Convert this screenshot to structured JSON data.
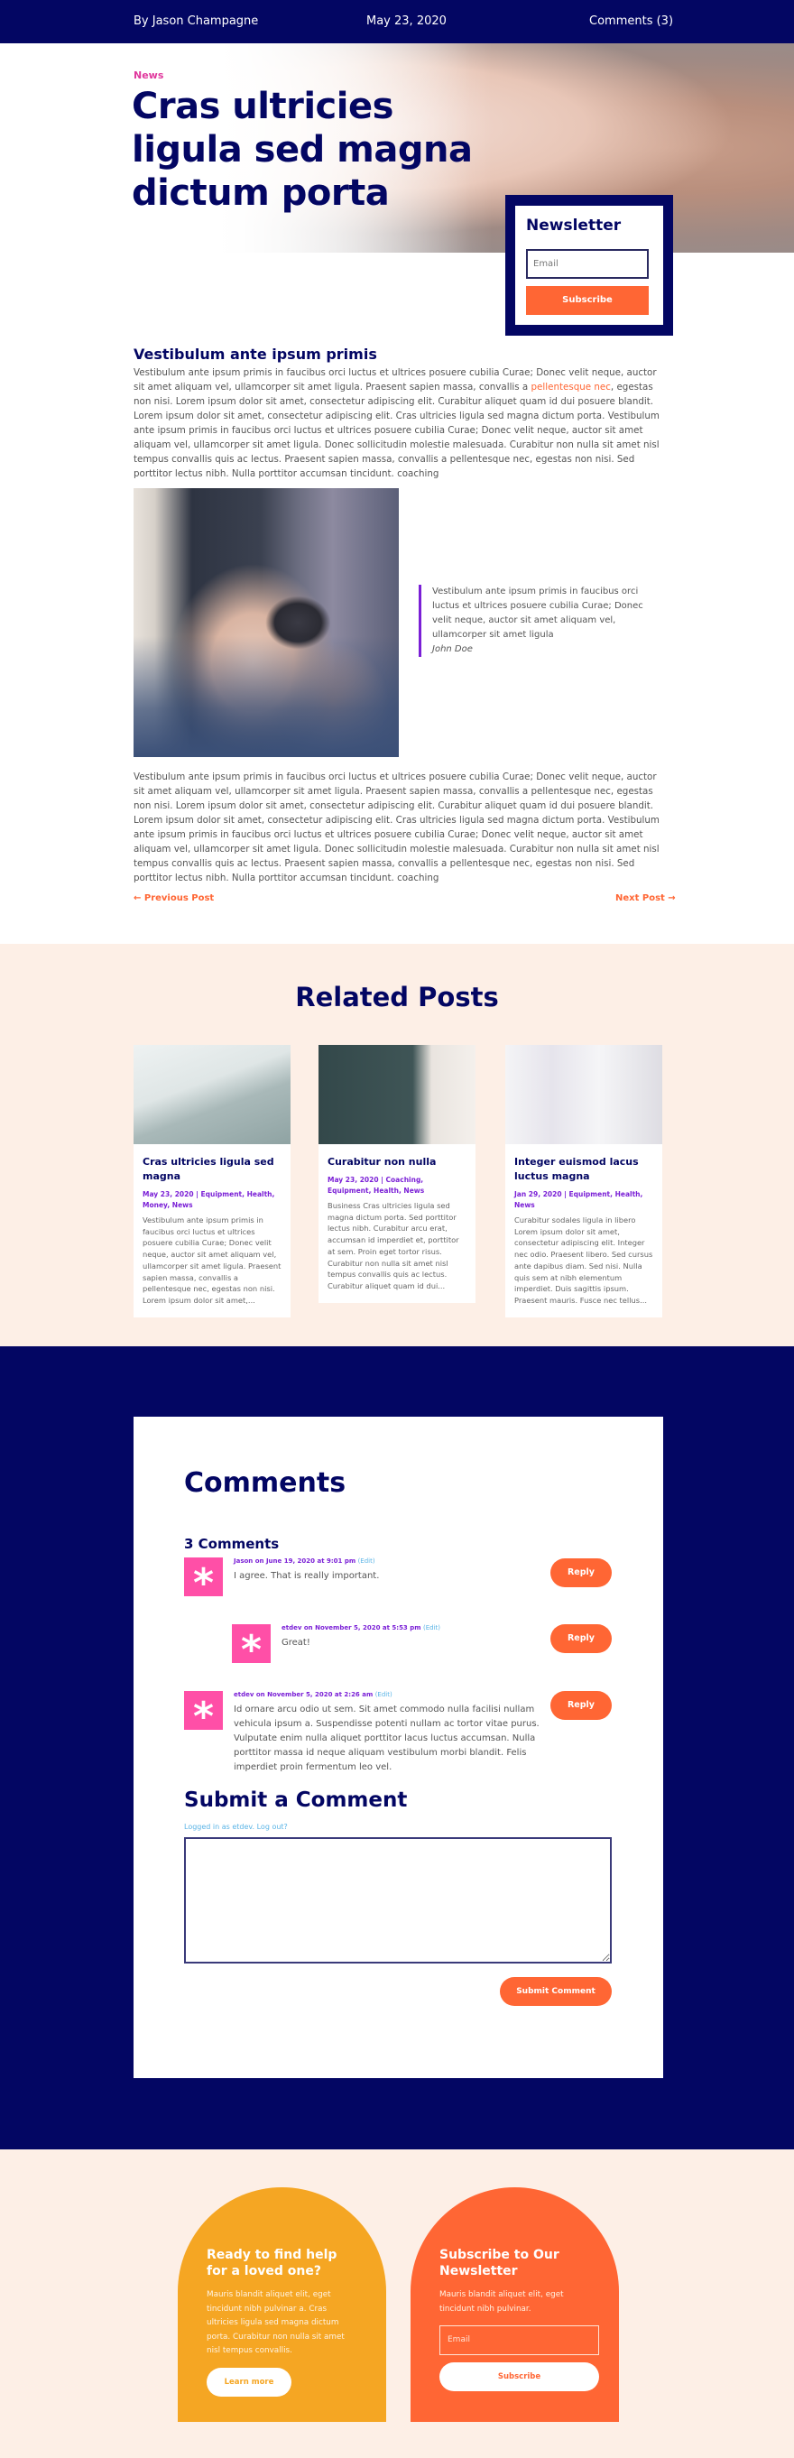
{
  "meta": {
    "author": "By Jason Champagne",
    "date": "May 23, 2020",
    "comments": "Comments (3)"
  },
  "hero": {
    "category": "News",
    "title": "Cras ultricies ligula sed magna dictum porta"
  },
  "newsletter": {
    "title": "Newsletter",
    "email_placeholder": "Email",
    "button": "Subscribe"
  },
  "article": {
    "heading": "Vestibulum ante ipsum primis",
    "para1_a": "Vestibulum ante ipsum primis in faucibus orci luctus et ultrices posuere cubilia Curae; Donec velit neque, auctor sit amet aliquam vel, ullamcorper sit amet ligula. Praesent sapien massa, convallis a ",
    "para1_link": "pellentesque nec",
    "para1_b": ", egestas non nisi. Lorem ipsum dolor sit amet, consectetur adipiscing elit. Curabitur aliquet quam id dui posuere blandit. Lorem ipsum dolor sit amet, consectetur adipiscing elit. Cras ultricies ligula sed magna dictum porta. Vestibulum ante ipsum primis in faucibus orci luctus et ultrices posuere cubilia Curae; Donec velit neque, auctor sit amet aliquam vel, ullamcorper sit amet ligula. Donec sollicitudin molestie malesuada. Curabitur non nulla sit amet nisl tempus convallis quis ac lectus. Praesent sapien massa, convallis a pellentesque nec, egestas non nisi. Sed porttitor lectus nibh. Nulla porttitor accumsan tincidunt. coaching",
    "quote": "Vestibulum ante ipsum primis in faucibus orci luctus et ultrices posuere cubilia Curae; Donec velit neque, auctor sit amet aliquam vel, ullamcorper sit amet ligula",
    "quote_author": "John Doe",
    "para2": "Vestibulum ante ipsum primis in faucibus orci luctus et ultrices posuere cubilia Curae; Donec velit neque, auctor sit amet aliquam vel, ullamcorper sit amet ligula. Praesent sapien massa, convallis a pellentesque nec, egestas non nisi. Lorem ipsum dolor sit amet, consectetur adipiscing elit. Curabitur aliquet quam id dui posuere blandit. Lorem ipsum dolor sit amet, consectetur adipiscing elit. Cras ultricies ligula sed magna dictum porta. Vestibulum ante ipsum primis in faucibus orci luctus et ultrices posuere cubilia Curae; Donec velit neque, auctor sit amet aliquam vel, ullamcorper sit amet ligula. Donec sollicitudin molestie malesuada. Curabitur non nulla sit amet nisl tempus convallis quis ac lectus. Praesent sapien massa, convallis a pellentesque nec, egestas non nisi. Sed porttitor lectus nibh. Nulla porttitor accumsan tincidunt. coaching",
    "prev": "← Previous Post",
    "next": "Next Post →"
  },
  "related": {
    "title": "Related Posts",
    "posts": [
      {
        "title": "Cras ultricies ligula sed magna",
        "meta": "May 23, 2020 | Equipment, Health, Money, News",
        "excerpt": "Vestibulum ante ipsum primis in faucibus orci luctus et ultrices posuere cubilia Curae; Donec velit neque, auctor sit amet aliquam vel, ullamcorper sit amet ligula. Praesent sapien massa, convallis a pellentesque nec, egestas non nisi. Lorem ipsum dolor sit amet,..."
      },
      {
        "title": "Curabitur non nulla",
        "meta": "May 23, 2020 | Coaching, Equipment, Health, News",
        "excerpt": "Business Cras ultricies ligula sed magna dictum porta. Sed porttitor lectus nibh. Curabitur arcu erat, accumsan id imperdiet et, porttitor at sem. Proin eget tortor risus. Curabitur non nulla sit amet nisl tempus convallis quis ac lectus. Curabitur aliquet quam id dui..."
      },
      {
        "title": "Integer euismod lacus luctus magna",
        "meta": "Jan 29, 2020 | Equipment, Health, News",
        "excerpt": "Curabitur sodales ligula in libero Lorem ipsum dolor sit amet, consectetur adipiscing elit. Integer nec odio. Praesent libero. Sed cursus ante dapibus diam. Sed nisi. Nulla quis sem at nibh elementum imperdiet. Duis sagittis ipsum. Praesent mauris. Fusce nec tellus..."
      }
    ]
  },
  "comments": {
    "title": "Comments",
    "count": "3 Comments",
    "items": [
      {
        "byline": "Jason on June 19, 2020 at 9:01 pm",
        "edit": "(Edit)",
        "text": "I agree. That is really important.",
        "reply": "Reply"
      },
      {
        "byline": "etdev on November 5, 2020 at 5:53 pm",
        "edit": "(Edit)",
        "text": "Great!",
        "reply": "Reply"
      },
      {
        "byline": "etdev on November 5, 2020 at 2:26 am",
        "edit": "(Edit)",
        "text": "Id ornare arcu odio ut sem. Sit amet commodo nulla facilisi nullam vehicula ipsum a. Suspendisse potenti nullam ac tortor vitae purus. Vulputate enim nulla aliquet porttitor lacus luctus accumsan. Nulla porttitor massa id neque aliquam vestibulum morbi blandit. Felis imperdiet proin fermentum leo vel.",
        "reply": "Reply"
      }
    ],
    "submit_title": "Submit a Comment",
    "logged_in": "Logged in as etdev. Log out?",
    "textarea_value": "",
    "submit_button": "Submit Comment"
  },
  "footer": {
    "help": {
      "title": "Ready to find help for a loved one?",
      "text": "Mauris blandit aliquet elit, eget tincidunt nibh pulvinar a. Cras ultricies ligula sed magna dictum porta. Curabitur non nulla sit amet nisl tempus convallis.",
      "button": "Learn more"
    },
    "subscribe": {
      "title": "Subscribe to Our Newsletter",
      "text": "Mauris blandit aliquet elit, eget tincidunt nibh pulvinar.",
      "email_placeholder": "Email",
      "button": "Subscribe"
    }
  },
  "colors": {
    "navy": "#030663",
    "orange": "#ff6634",
    "amber": "#f5a623",
    "pink": "#ff4fa7",
    "purple": "#7a1fd6",
    "beige": "#fdefe6"
  }
}
